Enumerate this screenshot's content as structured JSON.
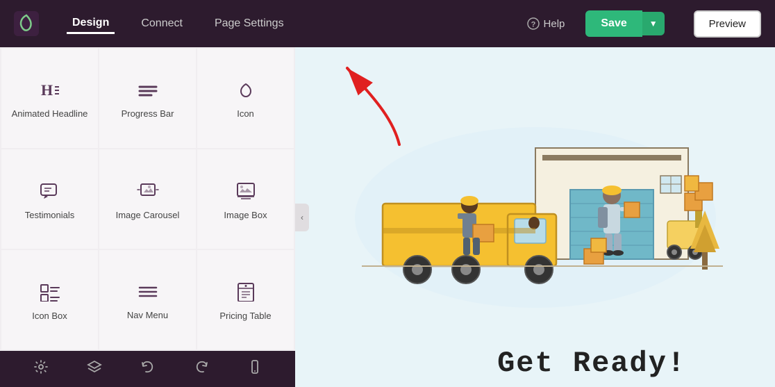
{
  "nav": {
    "tabs": [
      {
        "id": "design",
        "label": "Design",
        "active": true
      },
      {
        "id": "connect",
        "label": "Connect",
        "active": false
      },
      {
        "id": "page-settings",
        "label": "Page Settings",
        "active": false
      }
    ],
    "help_label": "Help",
    "save_label": "Save",
    "preview_label": "Preview"
  },
  "widgets": [
    {
      "id": "animated-headline",
      "label": "Animated Headline",
      "icon": "heading"
    },
    {
      "id": "progress-bar",
      "label": "Progress Bar",
      "icon": "progress"
    },
    {
      "id": "icon",
      "label": "Icon",
      "icon": "heart"
    },
    {
      "id": "testimonials",
      "label": "Testimonials",
      "icon": "chat"
    },
    {
      "id": "image-carousel",
      "label": "Image Carousel",
      "icon": "carousel"
    },
    {
      "id": "image-box",
      "label": "Image Box",
      "icon": "imagebox"
    },
    {
      "id": "icon-box",
      "label": "Icon Box",
      "icon": "iconbox"
    },
    {
      "id": "nav-menu",
      "label": "Nav Menu",
      "icon": "navmenu"
    },
    {
      "id": "pricing-table",
      "label": "Pricing Table",
      "icon": "pricing"
    }
  ],
  "toolbar": {
    "icons": [
      "settings",
      "layers",
      "history-back",
      "history-forward",
      "mobile"
    ]
  },
  "content": {
    "get_ready_text": "Get  Ready!"
  }
}
